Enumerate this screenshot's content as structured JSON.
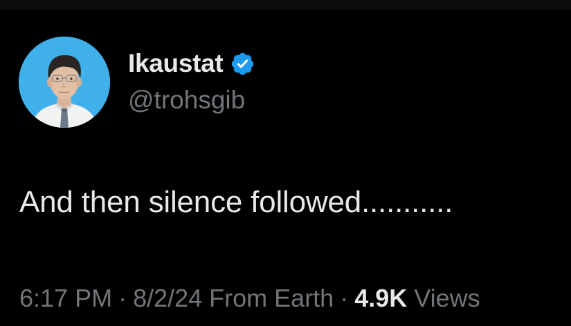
{
  "tweet": {
    "display_name": "Ikaustat",
    "handle": "@trohsgib",
    "verified": true,
    "verified_color": "#1d9bf0",
    "avatar_icon": "profile-photo",
    "text": "And then silence followed...........",
    "time": "6:17 PM",
    "date": "8/2/24",
    "source": "From Earth",
    "separator": "·",
    "views_count": "4.9K",
    "views_label": "Views"
  },
  "colors": {
    "background": "#000000",
    "primary_text": "#e7e9ea",
    "secondary_text": "#71767b",
    "avatar_bg": "#3fb0ea"
  }
}
